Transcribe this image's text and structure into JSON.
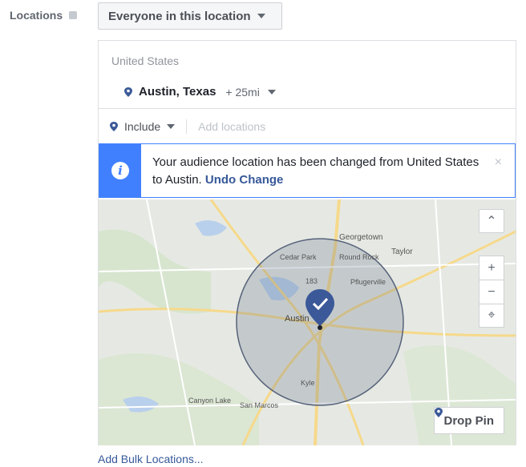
{
  "locations_label": "Locations",
  "audience_select": "Everyone in this location",
  "country": "United States",
  "city": "Austin, Texas",
  "radius": "+ 25mi",
  "include_label": "Include",
  "add_locations_placeholder": "Add locations",
  "notice": {
    "text": "Your audience location has been changed from United States to Austin.",
    "undo": "Undo Change",
    "close": "×"
  },
  "map": {
    "labels": [
      "Georgetown",
      "Taylor",
      "Cedar Park",
      "Round Rock",
      "183",
      "Pflugerville",
      "Austin",
      "Kyle",
      "Canyon Lake",
      "San Marcos"
    ],
    "zoom_up_icon": "chevron-up-icon",
    "zoom_in": "+",
    "zoom_out": "−",
    "recenter_icon": "locate-icon",
    "drop_pin": "Drop Pin"
  },
  "add_bulk": "Add Bulk Locations...",
  "colors": {
    "accent": "#4080ff",
    "pin": "#3b5998",
    "link": "#365899"
  }
}
